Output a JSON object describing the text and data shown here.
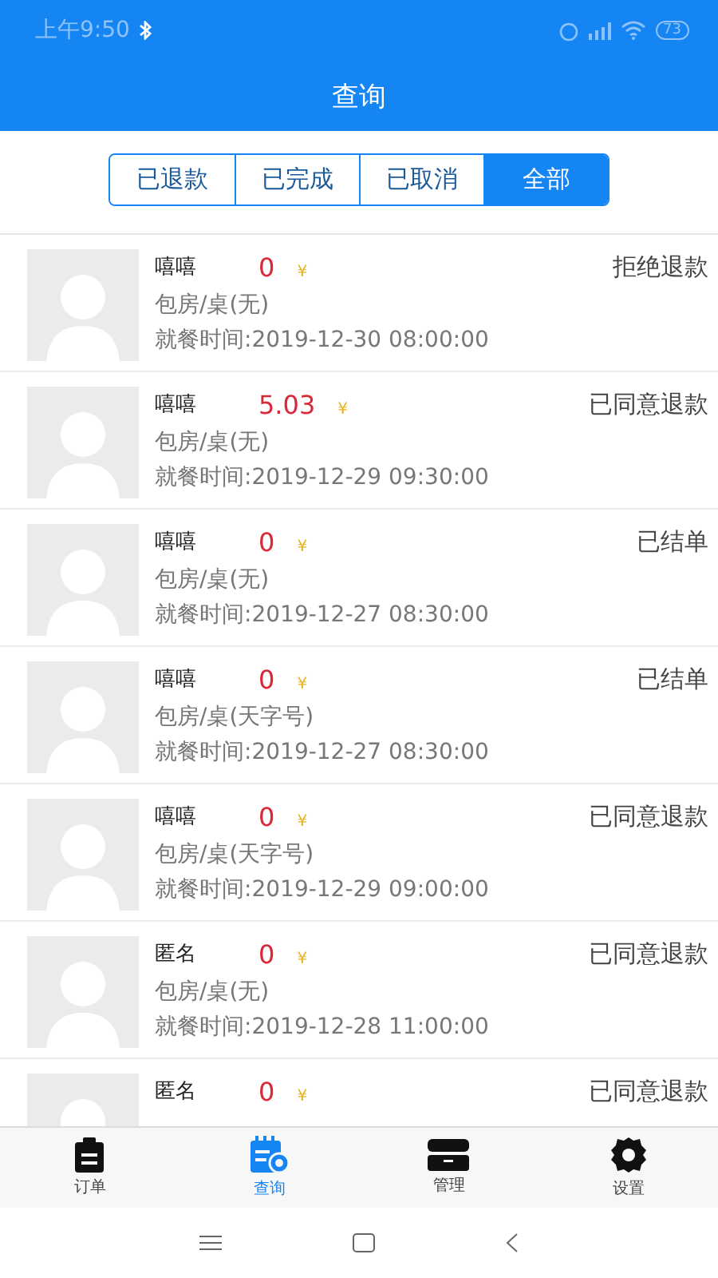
{
  "status_bar": {
    "time": "上午9:50",
    "battery": "73"
  },
  "header": {
    "title": "查询"
  },
  "filters": [
    {
      "label": "已退款",
      "selected": false
    },
    {
      "label": "已完成",
      "selected": false
    },
    {
      "label": "已取消",
      "selected": false
    },
    {
      "label": "全部",
      "selected": true
    }
  ],
  "orders": [
    {
      "name": "嘻嘻",
      "amount": "0",
      "currency": "¥",
      "status": "拒绝退款",
      "room": "包房/桌(无)",
      "time": "就餐时间:2019-12-30 08:00:00"
    },
    {
      "name": "嘻嘻",
      "amount": "5.03",
      "currency": "¥",
      "status": "已同意退款",
      "room": "包房/桌(无)",
      "time": "就餐时间:2019-12-29 09:30:00"
    },
    {
      "name": "嘻嘻",
      "amount": "0",
      "currency": "¥",
      "status": "已结单",
      "room": "包房/桌(无)",
      "time": "就餐时间:2019-12-27 08:30:00"
    },
    {
      "name": "嘻嘻",
      "amount": "0",
      "currency": "¥",
      "status": "已结单",
      "room": "包房/桌(天字号)",
      "time": "就餐时间:2019-12-27 08:30:00"
    },
    {
      "name": "嘻嘻",
      "amount": "0",
      "currency": "¥",
      "status": "已同意退款",
      "room": "包房/桌(天字号)",
      "time": "就餐时间:2019-12-29 09:00:00"
    },
    {
      "name": "匿名",
      "amount": "0",
      "currency": "¥",
      "status": "已同意退款",
      "room": "包房/桌(无)",
      "time": "就餐时间:2019-12-28 11:00:00"
    },
    {
      "name": "匿名",
      "amount": "0",
      "currency": "¥",
      "status": "已同意退款"
    }
  ],
  "tab_bar": [
    {
      "label": "订单",
      "kind": "clipboard",
      "selected": false
    },
    {
      "label": "查询",
      "kind": "calendar",
      "selected": true
    },
    {
      "label": "管理",
      "kind": "drawer",
      "selected": false
    },
    {
      "label": "设置",
      "kind": "gear",
      "selected": false
    }
  ]
}
